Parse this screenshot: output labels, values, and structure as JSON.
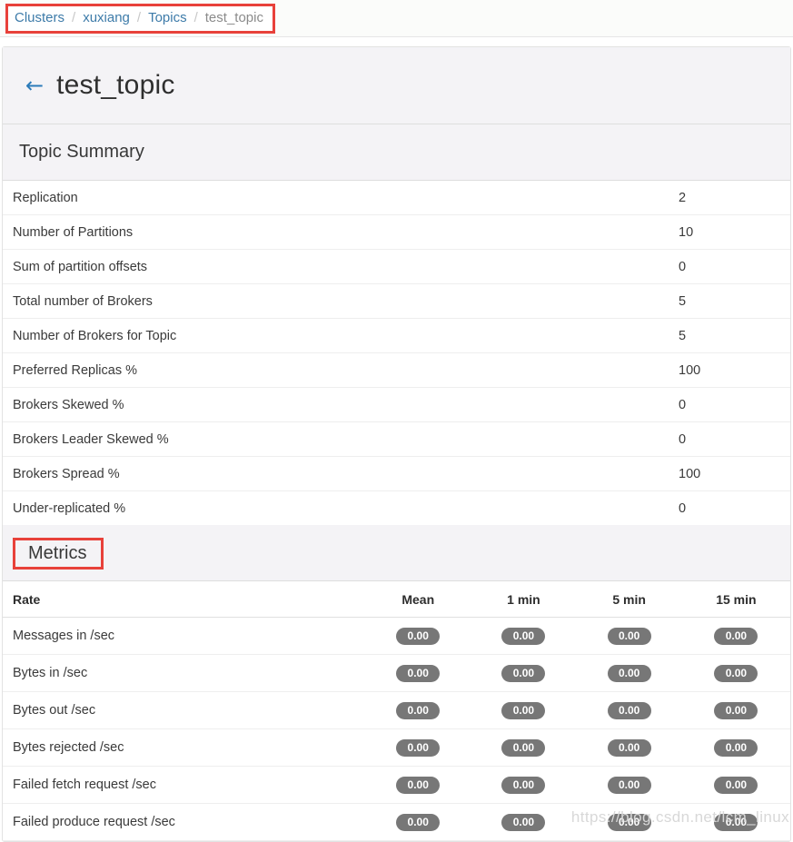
{
  "breadcrumb": {
    "items": [
      {
        "label": "Clusters",
        "type": "link"
      },
      {
        "label": "xuxiang",
        "type": "link"
      },
      {
        "label": "Topics",
        "type": "link"
      },
      {
        "label": "test_topic",
        "type": "active"
      }
    ],
    "separator": "/",
    "annotation_color": "#e8413a"
  },
  "header": {
    "back_icon": "←",
    "title": "test_topic"
  },
  "summary": {
    "heading": "Topic Summary",
    "rows": [
      {
        "label": "Replication",
        "value": "2"
      },
      {
        "label": "Number of Partitions",
        "value": "10"
      },
      {
        "label": "Sum of partition offsets",
        "value": "0"
      },
      {
        "label": "Total number of Brokers",
        "value": "5"
      },
      {
        "label": "Number of Brokers for Topic",
        "value": "5"
      },
      {
        "label": "Preferred Replicas %",
        "value": "100"
      },
      {
        "label": "Brokers Skewed %",
        "value": "0"
      },
      {
        "label": "Brokers Leader Skewed %",
        "value": "0"
      },
      {
        "label": "Brokers Spread %",
        "value": "100"
      },
      {
        "label": "Under-replicated %",
        "value": "0"
      }
    ]
  },
  "metrics": {
    "heading": "Metrics",
    "annotation_color": "#e8413a",
    "columns": [
      "Rate",
      "Mean",
      "1 min",
      "5 min",
      "15 min"
    ],
    "rows": [
      {
        "label": "Messages in /sec",
        "mean": "0.00",
        "m1": "0.00",
        "m5": "0.00",
        "m15": "0.00"
      },
      {
        "label": "Bytes in /sec",
        "mean": "0.00",
        "m1": "0.00",
        "m5": "0.00",
        "m15": "0.00"
      },
      {
        "label": "Bytes out /sec",
        "mean": "0.00",
        "m1": "0.00",
        "m5": "0.00",
        "m15": "0.00"
      },
      {
        "label": "Bytes rejected /sec",
        "mean": "0.00",
        "m1": "0.00",
        "m5": "0.00",
        "m15": "0.00"
      },
      {
        "label": "Failed fetch request /sec",
        "mean": "0.00",
        "m1": "0.00",
        "m5": "0.00",
        "m15": "0.00"
      },
      {
        "label": "Failed produce request /sec",
        "mean": "0.00",
        "m1": "0.00",
        "m5": "0.00",
        "m15": "0.00"
      }
    ],
    "badge_color": "#777777"
  },
  "watermark": {
    "text": "https://blog.csdn.net/lcm_linux"
  }
}
